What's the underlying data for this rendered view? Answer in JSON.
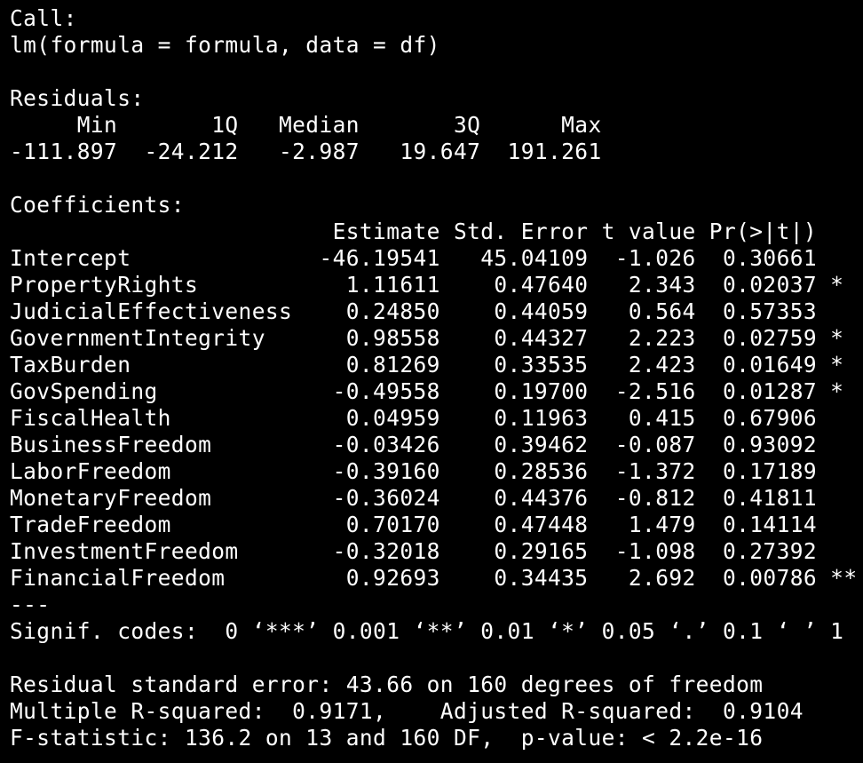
{
  "lines": [
    "Call:",
    "lm(formula = formula, data = df)",
    "",
    "Residuals:",
    "     Min       1Q   Median       3Q      Max ",
    "-111.897  -24.212   -2.987   19.647  191.261 ",
    "",
    "Coefficients:",
    "                        Estimate Std. Error t value Pr(>|t|)   ",
    "Intercept              -46.19541   45.04109  -1.026  0.30661   ",
    "PropertyRights           1.11611    0.47640   2.343  0.02037 * ",
    "JudicialEffectiveness    0.24850    0.44059   0.564  0.57353   ",
    "GovernmentIntegrity      0.98558    0.44327   2.223  0.02759 * ",
    "TaxBurden                0.81269    0.33535   2.423  0.01649 * ",
    "GovSpending             -0.49558    0.19700  -2.516  0.01287 * ",
    "FiscalHealth             0.04959    0.11963   0.415  0.67906   ",
    "BusinessFreedom         -0.03426    0.39462  -0.087  0.93092   ",
    "LaborFreedom            -0.39160    0.28536  -1.372  0.17189   ",
    "MonetaryFreedom         -0.36024    0.44376  -0.812  0.41811   ",
    "TradeFreedom             0.70170    0.47448   1.479  0.14114   ",
    "InvestmentFreedom       -0.32018    0.29165  -1.098  0.27392   ",
    "FinancialFreedom         0.92693    0.34435   2.692  0.00786 **",
    "---",
    "Signif. codes:  0 ‘***’ 0.001 ‘**’ 0.01 ‘*’ 0.05 ‘.’ 0.1 ‘ ’ 1",
    "",
    "Residual standard error: 43.66 on 160 degrees of freedom",
    "Multiple R-squared:  0.9171,    Adjusted R-squared:  0.9104 ",
    "F-statistic: 136.2 on 13 and 160 DF,  p-value: < 2.2e-16"
  ]
}
